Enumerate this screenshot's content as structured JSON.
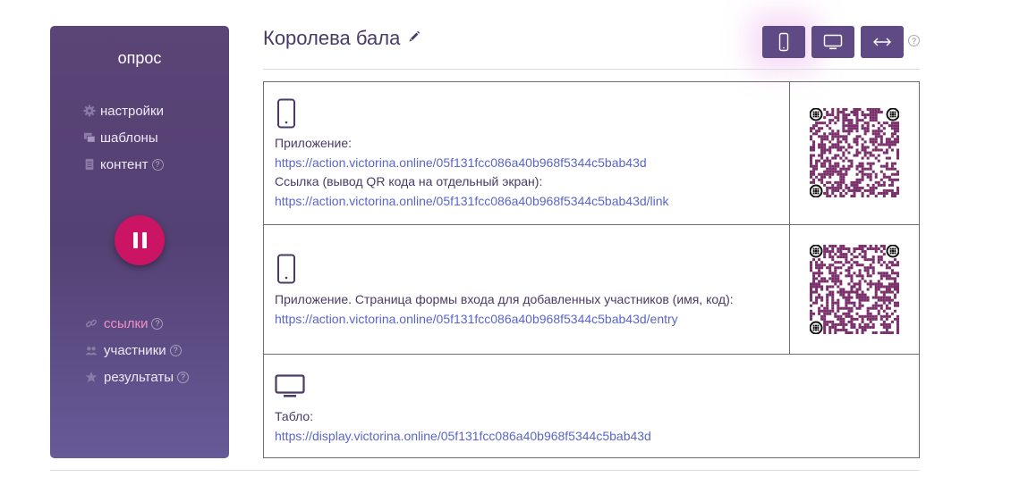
{
  "sidebar": {
    "title": "опрос",
    "items": [
      {
        "label": "настройки",
        "icon": "gear-icon"
      },
      {
        "label": "шаблоны",
        "icon": "templates-icon"
      },
      {
        "label": "контент",
        "icon": "document-icon",
        "help": "?"
      }
    ],
    "bottom_items": [
      {
        "label": "ссылки",
        "icon": "link-icon",
        "help": "?",
        "active": true
      },
      {
        "label": "участники",
        "icon": "users-icon",
        "help": "?"
      },
      {
        "label": "результаты",
        "icon": "star-icon",
        "help": "?"
      }
    ]
  },
  "header": {
    "title": "Королева бала",
    "help": "?"
  },
  "rows": [
    {
      "icon": "phone-icon",
      "label1": "Приложение:",
      "link1": "https://action.victorina.online/05f131fcc086a40b968f5344c5bab43d",
      "label2": "Ссылка (вывод QR кода на отдельный экран):",
      "link2": "https://action.victorina.online/05f131fcc086a40b968f5344c5bab43d/link"
    },
    {
      "icon": "phone-icon",
      "label1": "Приложение. Страница формы входа для добавленных участников (имя, код):",
      "link1": "https://action.victorina.online/05f131fcc086a40b968f5344c5bab43d/entry"
    },
    {
      "icon": "monitor-icon",
      "label1": "Табло:",
      "link1": "https://display.victorina.online/05f131fcc086a40b968f5344c5bab43d"
    }
  ],
  "colors": {
    "sidebar": "#5b4476",
    "accent": "#cc1464",
    "link": "#5a66c8",
    "active": "#f48fc4",
    "qr": "#7a2f6a"
  }
}
